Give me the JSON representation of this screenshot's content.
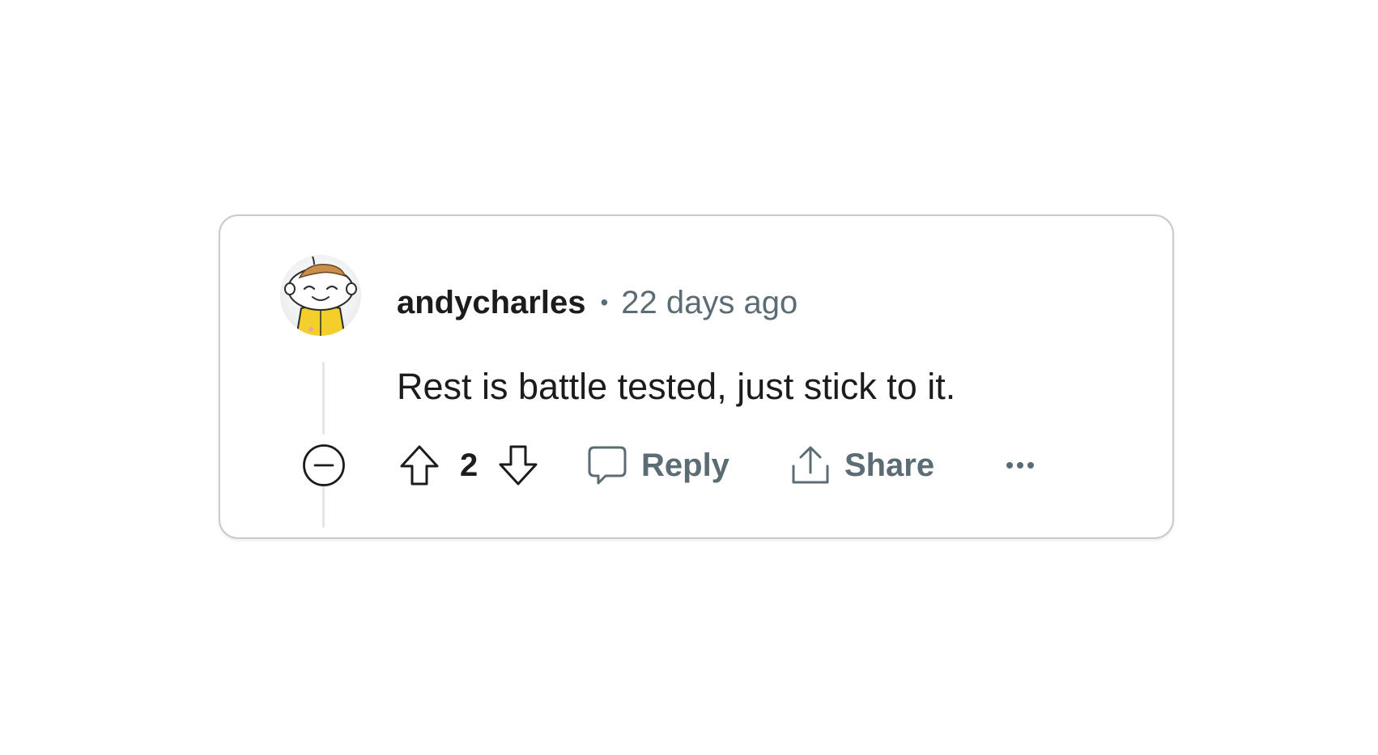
{
  "comment": {
    "username": "andycharles",
    "separator": "•",
    "timestamp": "22 days ago",
    "body": "Rest is battle tested, just stick to it.",
    "score": "2"
  },
  "actions": {
    "reply_label": "Reply",
    "share_label": "Share"
  },
  "icons": {
    "avatar": "snoo-avatar-icon",
    "collapse": "collapse-circle-minus-icon",
    "upvote": "arrow-up-outline-icon",
    "downvote": "arrow-down-outline-icon",
    "reply": "speech-bubble-icon",
    "share": "share-upload-icon",
    "more": "ellipsis-horizontal-icon"
  },
  "colors": {
    "text_primary": "#1a1c1e",
    "text_secondary": "#5c6c74",
    "border": "#c7cbcd",
    "thread_line": "#e3e5e7"
  }
}
